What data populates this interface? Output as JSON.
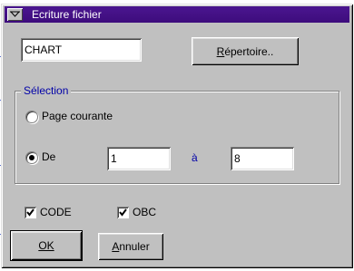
{
  "window": {
    "title": "Ecriture fichier"
  },
  "file": {
    "name_value": "CHART",
    "directory_button_label": "Répertoire.."
  },
  "selection": {
    "group_label": "Sélection",
    "current_page_label": "Page courante",
    "from_label": "De",
    "from_value": "1",
    "to_label": "à",
    "to_value": "8",
    "selected": "De"
  },
  "options": {
    "code_label": "CODE",
    "code_checked": true,
    "obc_label": "OBC",
    "obc_checked": true
  },
  "buttons": {
    "ok_label": "OK",
    "cancel_label": "Annuler"
  },
  "colors": {
    "titlebar": "#4b1690",
    "group_label": "#0000a8",
    "face": "#c0c0c0"
  },
  "icons": {
    "system_menu": "chevron-down-icon",
    "check": "checkmark-icon"
  }
}
